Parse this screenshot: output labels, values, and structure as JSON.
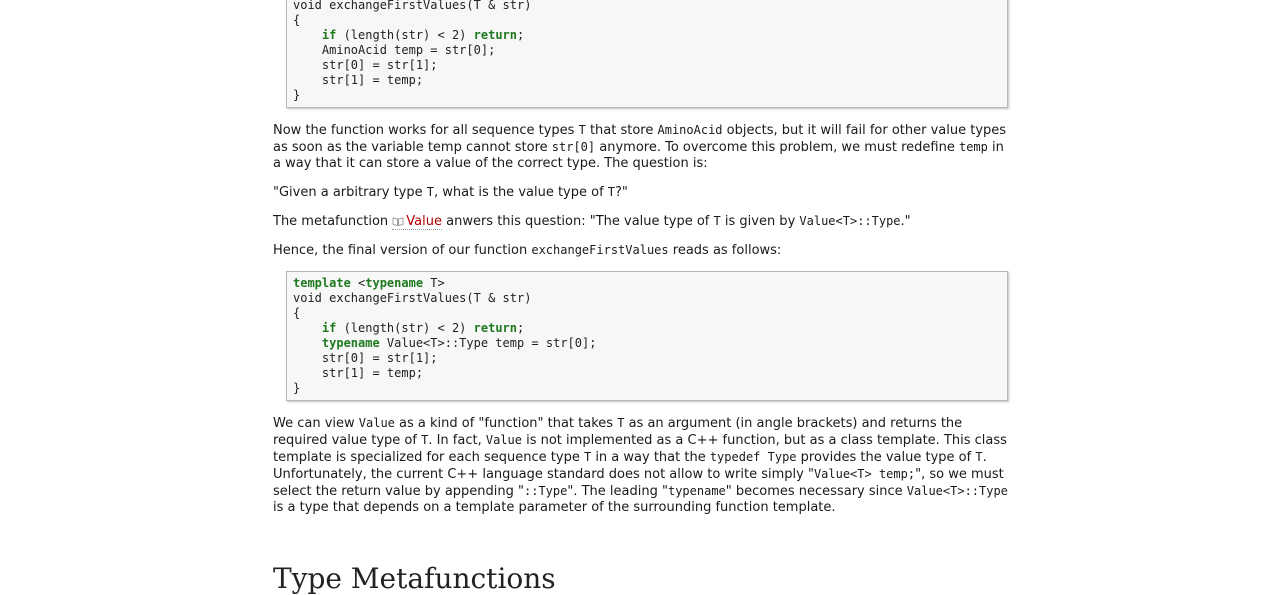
{
  "code1": {
    "line1": "void exchangeFirstValues(T & str)",
    "line2": "{",
    "line3_kw": "if",
    "line3_rest": " (length(str) < 2) ",
    "line3_ret": "return",
    "line3_end": ";",
    "line4": "AminoAcid temp = str[0];",
    "line5": "str[0] = str[1];",
    "line6": "str[1] = temp;",
    "line7": "}"
  },
  "para1": {
    "a": "Now the function works for all sequence types ",
    "t1": "T",
    "b": " that store ",
    "amino": "AminoAcid",
    "c": " objects, but it will fail for other value types as soon as the variable temp cannot store ",
    "str0": "str[0]",
    "d": " anymore. To overcome this problem, we must redefine ",
    "temp": "temp",
    "e": " in a way that it can store a value of the correct type. The question is:"
  },
  "para2": {
    "a": "\"Given a arbitrary type ",
    "t": "T",
    "b": ", what is the value type of ",
    "t2": "T",
    "c": "?\""
  },
  "para3": {
    "a": "The metafunction ",
    "link": "Value",
    "b": " anwers this question: \"The value type of ",
    "t": "T",
    "c": " is given by ",
    "code": "Value<T>::Type",
    "d": ".\""
  },
  "para4": {
    "a": "Hence, the final version of our function ",
    "fn": "exchangeFirstValues",
    "b": " reads as follows:"
  },
  "code2": {
    "line1_kw": "template",
    "line1_a": " <",
    "line1_kw2": "typename",
    "line1_b": " T>",
    "line2": "void exchangeFirstValues(T & str)",
    "line3": "{",
    "line4_kw": "if",
    "line4_rest": " (length(str) < 2) ",
    "line4_ret": "return",
    "line4_end": ";",
    "line5_kw": "typename",
    "line5_rest": " Value<T>::Type temp = str[0];",
    "line6": "str[0] = str[1];",
    "line7": "str[1] = temp;",
    "line8": "}"
  },
  "para5": {
    "a": "We can view ",
    "value1": "Value",
    "b": " as a kind of \"function\" that takes ",
    "t1": "T",
    "c": " as an argument (in angle brackets) and returns the required value type of ",
    "t2": "T",
    "d": ". In fact, ",
    "value2": "Value",
    "e": " is not implemented as a C++ function, but as a class template. This class template is specialized for each sequence type ",
    "t3": "T",
    "f": " in a way that the ",
    "typedef": "typedef Type",
    "g": " provides the value type of ",
    "t4": "T",
    "h": ". Unfortunately, the current C++ language standard does not allow to write simply \"",
    "code1": "Value<T> temp;",
    "i": "\", so we must select the return value by appending \"",
    "code2": "::Type",
    "j": "\". The leading \"",
    "code3": "typename",
    "k": "\" becomes necessary since ",
    "code4": "Value<T>::Type",
    "l": " is a type that depends on a template parameter of the surrounding function template."
  },
  "heading_stub": "Type Metafunctions"
}
